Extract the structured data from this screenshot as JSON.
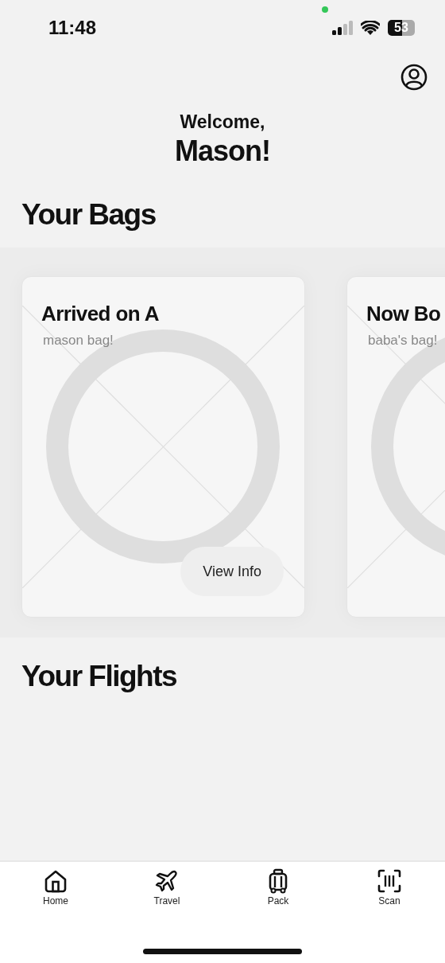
{
  "status_bar": {
    "time": "11:48",
    "battery": "53"
  },
  "greeting": {
    "line_1": "Welcome,",
    "line_2": "Mason!"
  },
  "bags": {
    "title": "Your Bags",
    "cards": [
      {
        "title": "Arrived on A",
        "subtitle": "mason bag!",
        "button": "View Info"
      },
      {
        "title": "Now Bo",
        "subtitle": "baba's bag!"
      }
    ]
  },
  "flights": {
    "title": "Your Flights"
  },
  "tab_bar": [
    {
      "label": "Home",
      "kind": "home"
    },
    {
      "label": "Travel",
      "kind": "plane"
    },
    {
      "label": "Pack",
      "kind": "luggage"
    },
    {
      "label": "Scan",
      "kind": "scan"
    }
  ]
}
